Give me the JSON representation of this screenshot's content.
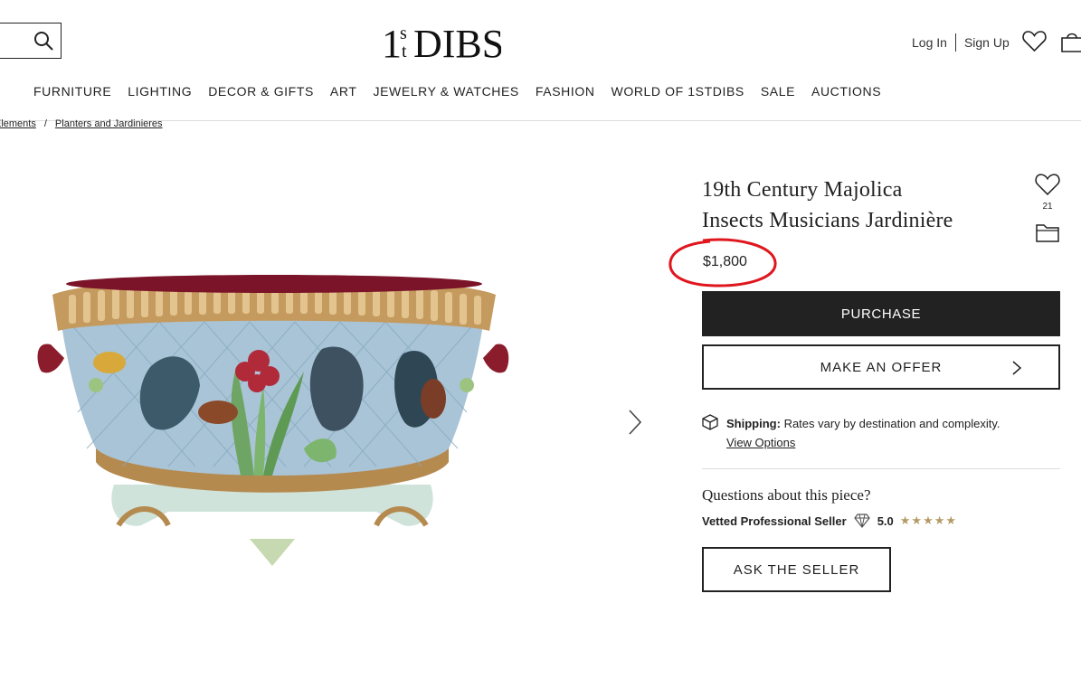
{
  "header": {
    "logo_text": "1stDIBS",
    "login_label": "Log In",
    "signup_label": "Sign Up"
  },
  "nav": {
    "items": [
      {
        "label": "FURNITURE"
      },
      {
        "label": "LIGHTING"
      },
      {
        "label": "DECOR & GIFTS"
      },
      {
        "label": "ART"
      },
      {
        "label": "JEWELRY & WATCHES"
      },
      {
        "label": "FASHION"
      },
      {
        "label": "WORLD OF 1STDIBS"
      },
      {
        "label": "SALE"
      },
      {
        "label": "AUCTIONS"
      }
    ]
  },
  "breadcrumb": {
    "items": [
      {
        "label": "Elements"
      },
      {
        "label": "Planters and Jardinieres"
      }
    ],
    "separator": "/"
  },
  "product": {
    "title_line1": "19th Century Majolica",
    "title_line2": "Insects Musicians Jardinière",
    "favorite_count": "21",
    "price": "$1,800",
    "price_highlight_color": "#e0161e"
  },
  "actions": {
    "purchase_label": "PURCHASE",
    "offer_label": "MAKE AN OFFER",
    "ask_label": "ASK THE SELLER"
  },
  "shipping": {
    "label": "Shipping:",
    "text": "Rates vary by destination and complexity.",
    "view_options_label": "View Options"
  },
  "seller": {
    "questions_label": "Questions about this piece?",
    "vetted_label": "Vetted Professional Seller",
    "rating": "5.0",
    "stars": 5
  },
  "icons": {
    "search": "search-icon",
    "heart": "heart-icon",
    "bag": "shopping-bag-icon",
    "folder": "folder-icon",
    "chevron": "chevron-right-icon",
    "box": "shipping-box-icon",
    "diamond": "diamond-icon",
    "star": "star-icon"
  },
  "colors": {
    "primary_button": "#222222",
    "star": "#b59a66"
  }
}
